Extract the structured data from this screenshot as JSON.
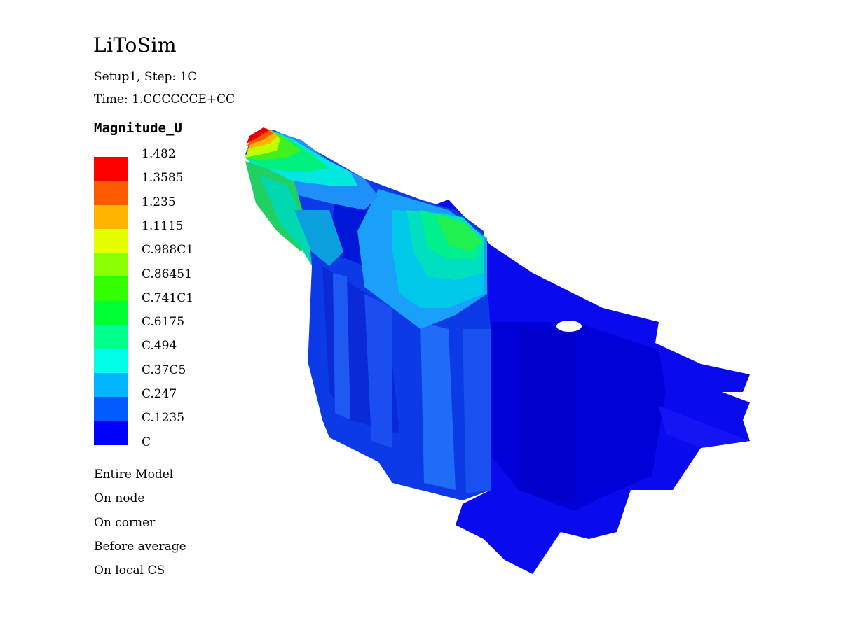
{
  "app": {
    "title": "LiToSim",
    "setup_line": "Setup1, Step: 1C",
    "time_line": "Time: 1.CCCCCCE+CC"
  },
  "legend": {
    "variable": "Magnitude_U",
    "labels": [
      "1.482",
      "1.3585",
      "1.235",
      "1.1115",
      "C.988C1",
      "C.86451",
      "C.741C1",
      "C.6175",
      "C.494",
      "C.37C5",
      "C.247",
      "C.1235",
      "C"
    ],
    "colors": [
      "#ff0000",
      "#ff5a00",
      "#ffb400",
      "#e6ff00",
      "#8cff00",
      "#32ff00",
      "#00ff32",
      "#00ff8c",
      "#00ffe6",
      "#00b4ff",
      "#005aff",
      "#0000ff"
    ]
  },
  "options": [
    "Entire Model",
    "On node",
    "On corner",
    "Before average",
    "On local CS"
  ]
}
